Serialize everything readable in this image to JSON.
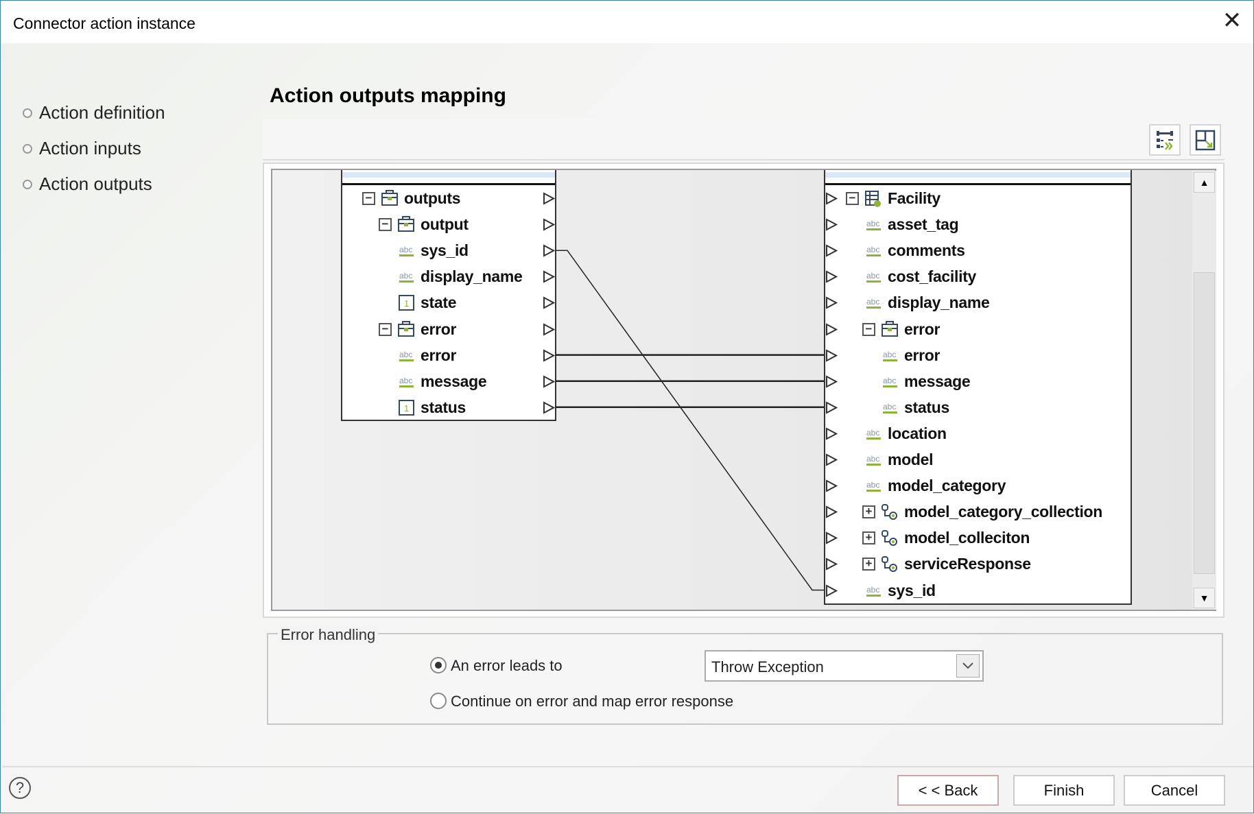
{
  "window": {
    "title": "Connector action instance"
  },
  "nav": {
    "items": [
      {
        "label": "Action definition"
      },
      {
        "label": "Action inputs"
      },
      {
        "label": "Action outputs"
      }
    ]
  },
  "page": {
    "heading": "Action outputs mapping"
  },
  "toolbar": {
    "buttons": [
      {
        "icon": "auto-map-icon"
      },
      {
        "icon": "expand-layout-icon"
      }
    ]
  },
  "source_tree": {
    "rows": [
      {
        "label": "outputs",
        "type": "group",
        "level": 0,
        "expanded": true
      },
      {
        "label": "output",
        "type": "group",
        "level": 1,
        "expanded": true
      },
      {
        "label": "sys_id",
        "type": "string",
        "level": 2
      },
      {
        "label": "display_name",
        "type": "string",
        "level": 2
      },
      {
        "label": "state",
        "type": "integer",
        "level": 2
      },
      {
        "label": "error",
        "type": "group",
        "level": 1,
        "expanded": true
      },
      {
        "label": "error",
        "type": "string",
        "level": 2
      },
      {
        "label": "message",
        "type": "string",
        "level": 2
      },
      {
        "label": "status",
        "type": "integer",
        "level": 2
      }
    ]
  },
  "target_tree": {
    "rows": [
      {
        "label": "Facility",
        "type": "table",
        "level": 0,
        "expanded": true
      },
      {
        "label": "asset_tag",
        "type": "string",
        "level": 1
      },
      {
        "label": "comments",
        "type": "string",
        "level": 1
      },
      {
        "label": "cost_facility",
        "type": "string",
        "level": 1
      },
      {
        "label": "display_name",
        "type": "string",
        "level": 1
      },
      {
        "label": "error",
        "type": "group",
        "level": 1,
        "expanded": true
      },
      {
        "label": "error",
        "type": "string",
        "level": 2
      },
      {
        "label": "message",
        "type": "string",
        "level": 2
      },
      {
        "label": "status",
        "type": "string",
        "level": 2
      },
      {
        "label": "location",
        "type": "string",
        "level": 1
      },
      {
        "label": "model",
        "type": "string",
        "level": 1
      },
      {
        "label": "model_category",
        "type": "string",
        "level": 1
      },
      {
        "label": "model_category_collection",
        "type": "collection",
        "level": 1,
        "expanded": false
      },
      {
        "label": "model_colleciton",
        "type": "collection",
        "level": 1,
        "expanded": false
      },
      {
        "label": "serviceResponse",
        "type": "collection",
        "level": 1,
        "expanded": false
      },
      {
        "label": "sys_id",
        "type": "string",
        "level": 1
      }
    ]
  },
  "mappings": [
    {
      "from": "outputs.output.sys_id",
      "to": "Facility.sys_id",
      "source_row": 2,
      "target_row": 15
    },
    {
      "from": "outputs.error.error",
      "to": "Facility.error.error",
      "source_row": 6,
      "target_row": 6
    },
    {
      "from": "outputs.error.message",
      "to": "Facility.error.message",
      "source_row": 7,
      "target_row": 7
    },
    {
      "from": "outputs.error.status",
      "to": "Facility.error.status",
      "source_row": 8,
      "target_row": 8
    }
  ],
  "error_handling": {
    "legend": "Error handling",
    "options": [
      {
        "label": "An error leads to",
        "selected": true
      },
      {
        "label": "Continue on error and map error response",
        "selected": false
      }
    ],
    "select_value": "Throw Exception"
  },
  "footer": {
    "back": "< < Back",
    "finish": "Finish",
    "cancel": "Cancel",
    "help_icon": "help-icon"
  },
  "colors": {
    "accent_green": "#8db43a",
    "icon_dark": "#34495e",
    "header_blue": "#dce6fb"
  }
}
